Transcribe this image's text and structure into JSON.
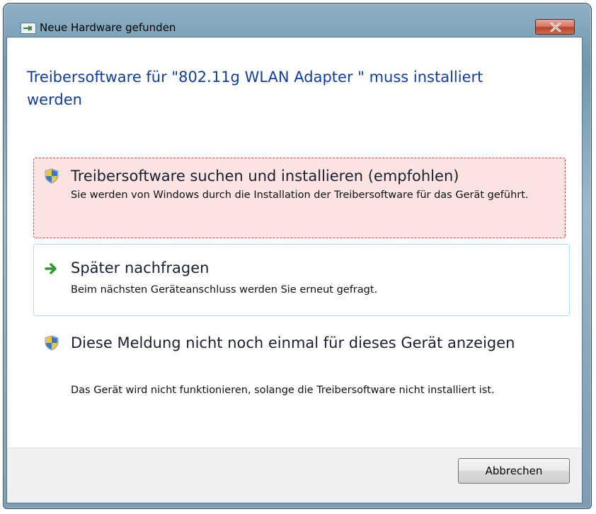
{
  "window": {
    "title": "Neue Hardware gefunden",
    "icon": "hardware-wizard-icon",
    "close_icon": "close-icon"
  },
  "heading": "Treibersoftware für \"802.11g WLAN Adapter    \" muss installiert werden",
  "options": [
    {
      "icon": "uac-shield-icon",
      "title": "Treibersoftware suchen und installieren (empfohlen)",
      "description": "Sie werden von Windows durch die Installation der Treibersoftware für das Gerät geführt.",
      "state": "focused"
    },
    {
      "icon": "green-arrow-icon",
      "title": "Später nachfragen",
      "description": "Beim nächsten Geräteanschluss werden Sie erneut gefragt.",
      "state": "hover"
    },
    {
      "icon": "uac-shield-icon",
      "title": "Diese Meldung nicht noch einmal für dieses Gerät anzeigen",
      "description": "Das Gerät wird nicht funktionieren, solange die Treibersoftware nicht installiert ist.",
      "state": "normal"
    }
  ],
  "footer": {
    "cancel_label": "Abbrechen"
  },
  "colors": {
    "heading": "#0e3ea0",
    "focus_bg": "#fbe3e2",
    "focus_border": "#e0433c",
    "hover_border": "#a5dff0"
  }
}
